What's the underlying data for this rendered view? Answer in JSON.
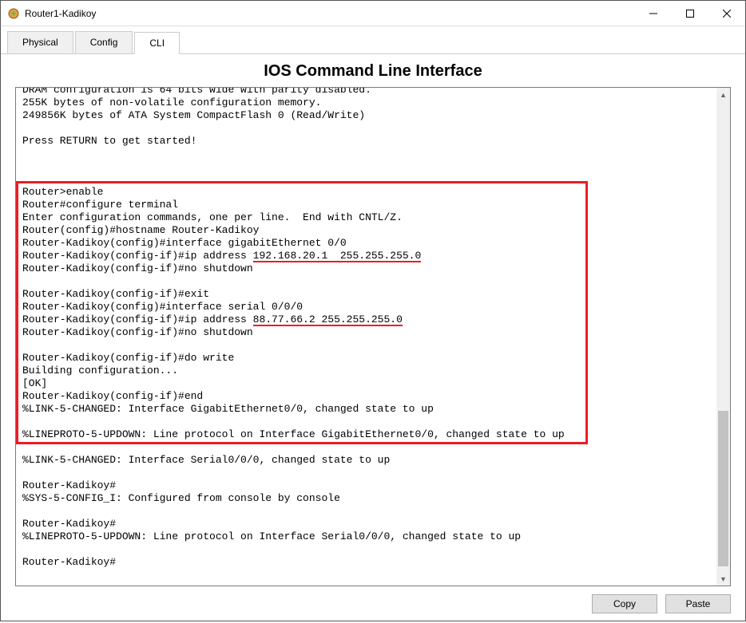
{
  "window": {
    "title": "Router1-Kadikoy"
  },
  "tabs": {
    "physical": "Physical",
    "config": "Config",
    "cli": "CLI"
  },
  "heading": "IOS Command Line Interface",
  "buttons": {
    "copy": "Copy",
    "paste": "Paste"
  },
  "terminal": {
    "lines": [
      "DRAM configuration is 64 bits wide with parity disabled.",
      "255K bytes of non-volatile configuration memory.",
      "249856K bytes of ATA System CompactFlash 0 (Read/Write)",
      "",
      "Press RETURN to get started!",
      "",
      "",
      "",
      "Router>enable",
      "Router#configure terminal",
      "Enter configuration commands, one per line.  End with CNTL/Z.",
      "Router(config)#hostname Router-Kadikoy",
      "Router-Kadikoy(config)#interface gigabitEthernet 0/0",
      "Router-Kadikoy(config-if)#ip address 192.168.20.1  255.255.255.0",
      "Router-Kadikoy(config-if)#no shutdown",
      "",
      "Router-Kadikoy(config-if)#exit",
      "Router-Kadikoy(config)#interface serial 0/0/0",
      "Router-Kadikoy(config-if)#ip address 88.77.66.2 255.255.255.0",
      "Router-Kadikoy(config-if)#no shutdown",
      "",
      "Router-Kadikoy(config-if)#do write",
      "Building configuration...",
      "[OK]",
      "Router-Kadikoy(config-if)#end",
      "%LINK-5-CHANGED: Interface GigabitEthernet0/0, changed state to up",
      "",
      "%LINEPROTO-5-UPDOWN: Line protocol on Interface GigabitEthernet0/0, changed state to up",
      "",
      "%LINK-5-CHANGED: Interface Serial0/0/0, changed state to up",
      "",
      "Router-Kadikoy#",
      "%SYS-5-CONFIG_I: Configured from console by console",
      "",
      "Router-Kadikoy#",
      "%LINEPROTO-5-UPDOWN: Line protocol on Interface Serial0/0/0, changed state to up",
      "",
      "Router-Kadikoy#"
    ]
  },
  "annotations": {
    "highlight_color": "#ed1c24",
    "box_start_line_index": 8,
    "box_end_line_index": 27,
    "underline1_text": "192.168.20.1  255.255.255.0",
    "underline2_text": "88.77.66.2 255.255.255.0"
  }
}
